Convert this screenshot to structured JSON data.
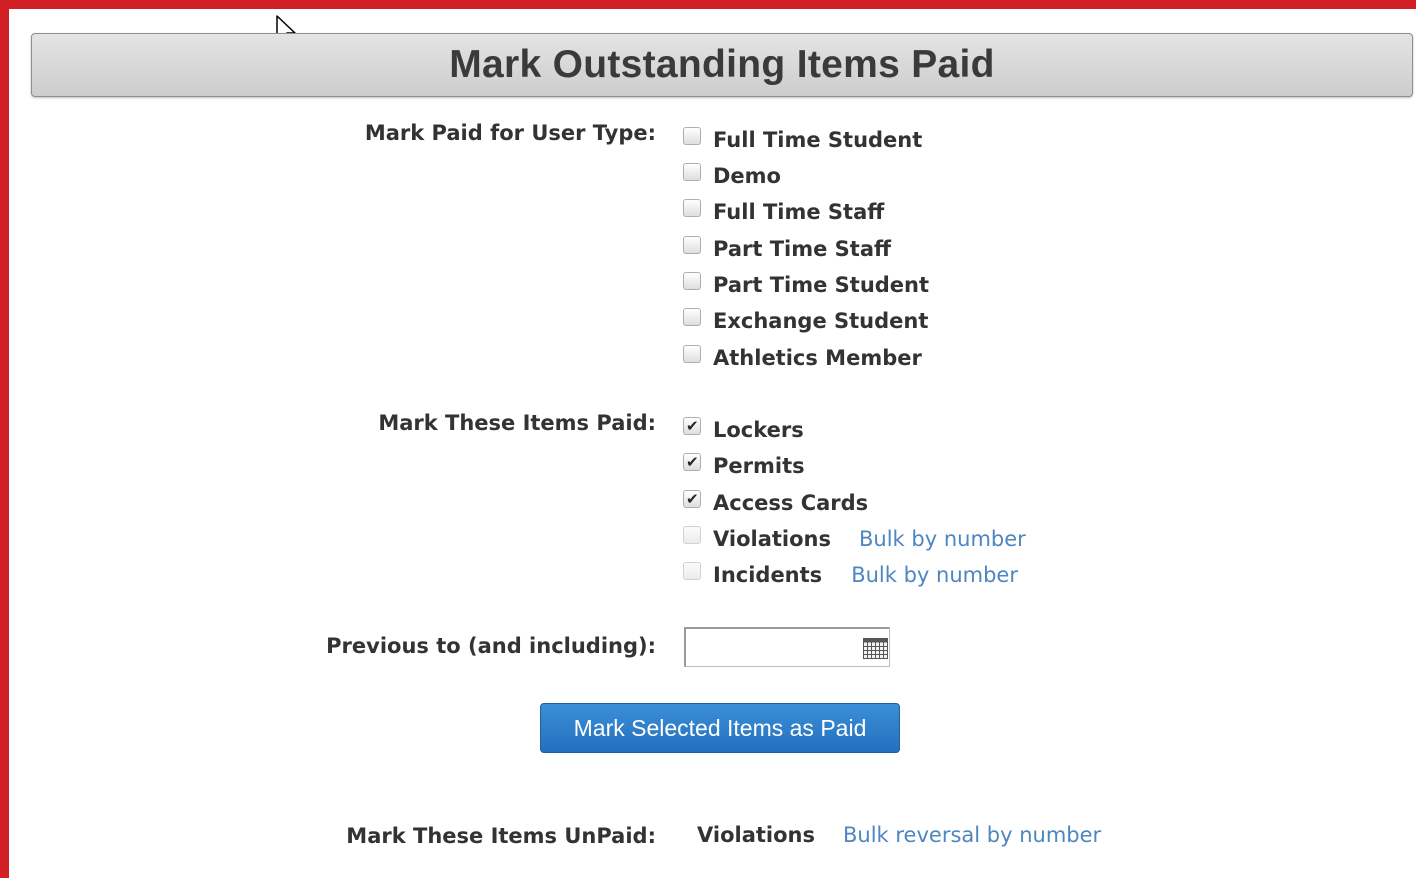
{
  "header": {
    "title": "Mark Outstanding Items Paid"
  },
  "user_types": {
    "label": "Mark Paid for User Type:",
    "options": [
      {
        "label": "Full Time Student",
        "checked": false
      },
      {
        "label": "Demo",
        "checked": false
      },
      {
        "label": "Full Time Staff",
        "checked": false
      },
      {
        "label": "Part Time Staff",
        "checked": false
      },
      {
        "label": "Part Time Student",
        "checked": false
      },
      {
        "label": "Exchange Student",
        "checked": false
      },
      {
        "label": "Athletics Member",
        "checked": false
      }
    ]
  },
  "items_paid": {
    "label": "Mark These Items Paid:",
    "options": [
      {
        "label": "Lockers",
        "checked": true,
        "disabled": false
      },
      {
        "label": "Permits",
        "checked": true,
        "disabled": false
      },
      {
        "label": "Access Cards",
        "checked": true,
        "disabled": false
      },
      {
        "label": "Violations",
        "checked": false,
        "disabled": true,
        "link": "Bulk by number"
      },
      {
        "label": "Incidents",
        "checked": false,
        "disabled": true,
        "link": "Bulk by number"
      }
    ]
  },
  "previous_to": {
    "label": "Previous to (and including):",
    "value": ""
  },
  "submit": {
    "label": "Mark Selected Items as Paid"
  },
  "unpaid": {
    "label": "Mark These Items UnPaid:",
    "item": "Violations",
    "link": "Bulk reversal by number"
  },
  "colors": {
    "frame": "#d21f25",
    "link": "#4d86c0",
    "button": "#2a7ac6",
    "text": "#333333"
  }
}
